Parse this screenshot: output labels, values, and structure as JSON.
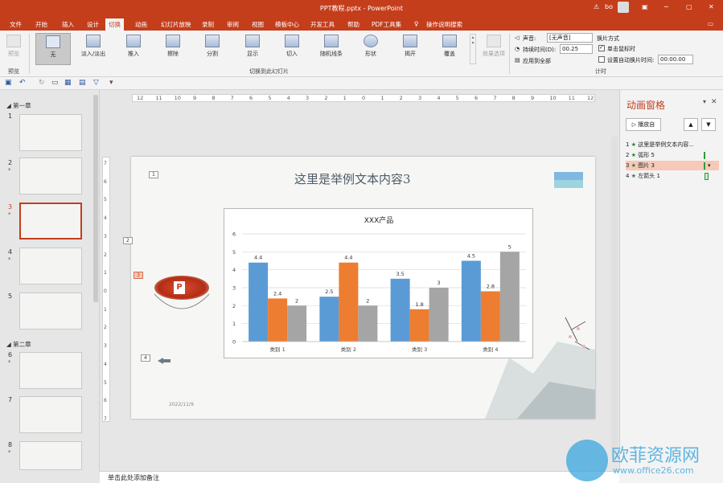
{
  "app": {
    "window_title": "PPT教程.pptx - PowerPoint",
    "user": "bo",
    "warning_icon": "warning-icon",
    "ribbon_display_icon": "ribbon-display-icon",
    "minimize": "─",
    "restore": "▢",
    "close": "✕"
  },
  "tabs": [
    "文件",
    "开始",
    "插入",
    "设计",
    "切换",
    "动画",
    "幻灯片放映",
    "录制",
    "审阅",
    "视图",
    "模板中心",
    "开发工具",
    "帮助",
    "PDF工具集"
  ],
  "active_tab": "切换",
  "tell_me": "操作说明搜索",
  "comment_icon": "comment-icon",
  "ribbon": {
    "preview": "预览",
    "preview_group": "预览",
    "transitions": [
      "无",
      "淡入/淡出",
      "推入",
      "擦除",
      "分割",
      "显示",
      "切入",
      "随机线条",
      "形状",
      "揭开",
      "覆盖"
    ],
    "effect_options": "效果选项",
    "group_label": "切换到此幻灯片",
    "sound_label": "声音:",
    "sound_value": "[无声音]",
    "duration_label": "持续时间(D):",
    "duration_value": "00.25",
    "apply_all": "应用到全部",
    "advance_label": "换片方式",
    "on_click": "单击鼠标时",
    "on_click_checked": true,
    "after_label": "设置自动换片时间:",
    "after_value": "00:00.00",
    "after_checked": false,
    "timing_group": "计时"
  },
  "sections": [
    "第一章",
    "第二章"
  ],
  "slides": [
    {
      "num": "1",
      "star": ""
    },
    {
      "num": "2",
      "star": "*"
    },
    {
      "num": "3",
      "star": "*"
    },
    {
      "num": "4",
      "star": "*"
    },
    {
      "num": "5",
      "star": ""
    },
    {
      "num": "6",
      "star": "*"
    },
    {
      "num": "7",
      "star": ""
    },
    {
      "num": "8",
      "star": "*"
    }
  ],
  "slide": {
    "title": "这里是举例文本内容3",
    "date": "2022/11/9",
    "anno": [
      "1",
      "2",
      "3",
      "4"
    ]
  },
  "chart_data": {
    "type": "bar",
    "title": "XXX产品",
    "categories": [
      "类别 1",
      "类别 2",
      "类别 3",
      "类别 4"
    ],
    "series": [
      {
        "values": [
          4.4,
          2.5,
          3.5,
          4.5
        ],
        "color": "#5b9bd5"
      },
      {
        "values": [
          2.4,
          4.4,
          1.8,
          2.8
        ],
        "color": "#ed7d31"
      },
      {
        "values": [
          2,
          2,
          3,
          5
        ],
        "color": "#a5a5a5"
      }
    ],
    "ylim": [
      0,
      6
    ],
    "yticks": [
      "0",
      "1",
      "2",
      "3",
      "4",
      "5",
      "6"
    ],
    "grid": true
  },
  "animation_pane": {
    "title": "动画窗格",
    "play_button": "播放自",
    "items": [
      {
        "num": "1",
        "label": "这里是举例文本内容..."
      },
      {
        "num": "2",
        "label": "弧形 5"
      },
      {
        "num": "3",
        "label": "图片 3"
      },
      {
        "num": "4",
        "label": "左箭头 1"
      }
    ]
  },
  "notes": "单击此处添加备注",
  "watermark": {
    "brand": "欧菲资源网",
    "url": "www.office26.com"
  },
  "ruler": {
    "h": [
      "12",
      "11",
      "10",
      "9",
      "8",
      "7",
      "6",
      "5",
      "4",
      "3",
      "2",
      "1",
      "0",
      "1",
      "2",
      "3",
      "4",
      "5",
      "6",
      "7",
      "8",
      "9",
      "10",
      "11",
      "12"
    ],
    "v": [
      "7",
      "6",
      "5",
      "4",
      "3",
      "2",
      "1",
      "0",
      "1",
      "2",
      "3",
      "4",
      "5",
      "6",
      "7"
    ]
  }
}
